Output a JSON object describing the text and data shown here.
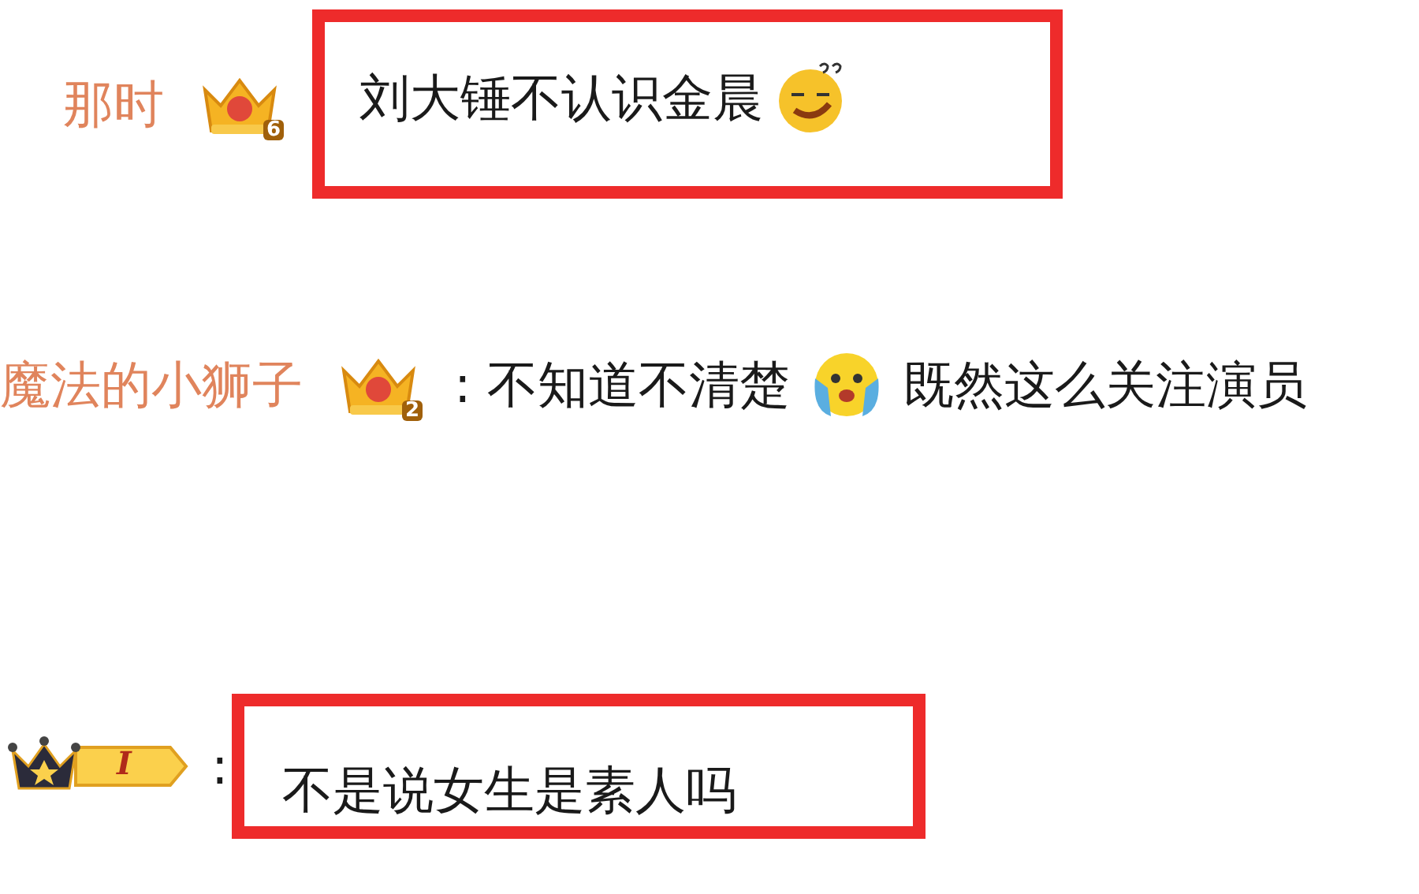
{
  "comments": [
    {
      "username": "那时",
      "badge": {
        "kind": "crown",
        "level": "6"
      },
      "highlighted": true,
      "segments": [
        {
          "kind": "text",
          "text": "刘大锤不认识金晨"
        },
        {
          "kind": "squint_emoji"
        }
      ]
    },
    {
      "username": "魔法的小狮子",
      "badge": {
        "kind": "crown",
        "level": "2"
      },
      "highlighted": false,
      "separator": ":",
      "segments": [
        {
          "kind": "text",
          "text": "不知道不清楚"
        },
        {
          "kind": "teary_emoji"
        },
        {
          "kind": "text",
          "text": "既然这么关注演员"
        }
      ]
    },
    {
      "badge": {
        "kind": "member",
        "level": "I"
      },
      "highlighted": true,
      "separator": ":",
      "segments": [
        {
          "kind": "text",
          "text": "不是说女生是素人吗"
        }
      ]
    }
  ]
}
